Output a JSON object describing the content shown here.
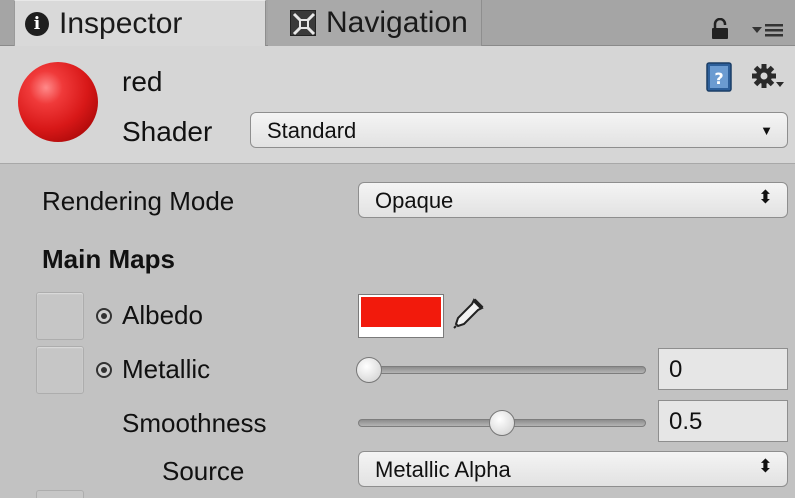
{
  "tabs": {
    "inspector": {
      "label": "Inspector",
      "icon": "info-icon"
    },
    "navigation": {
      "label": "Navigation",
      "icon": "navmesh-icon"
    }
  },
  "header": {
    "material_name": "red",
    "shader_label": "Shader",
    "shader_value": "Standard",
    "preview_color": "#d81818"
  },
  "rendering_mode": {
    "label": "Rendering Mode",
    "value": "Opaque"
  },
  "main_maps": {
    "title": "Main Maps",
    "albedo": {
      "label": "Albedo",
      "color": "#f21a0c"
    },
    "metallic": {
      "label": "Metallic",
      "value": "0",
      "level": 0
    },
    "smoothness": {
      "label": "Smoothness",
      "value": "0.5",
      "level": 0.5
    },
    "source": {
      "label": "Source",
      "value": "Metallic Alpha"
    }
  }
}
